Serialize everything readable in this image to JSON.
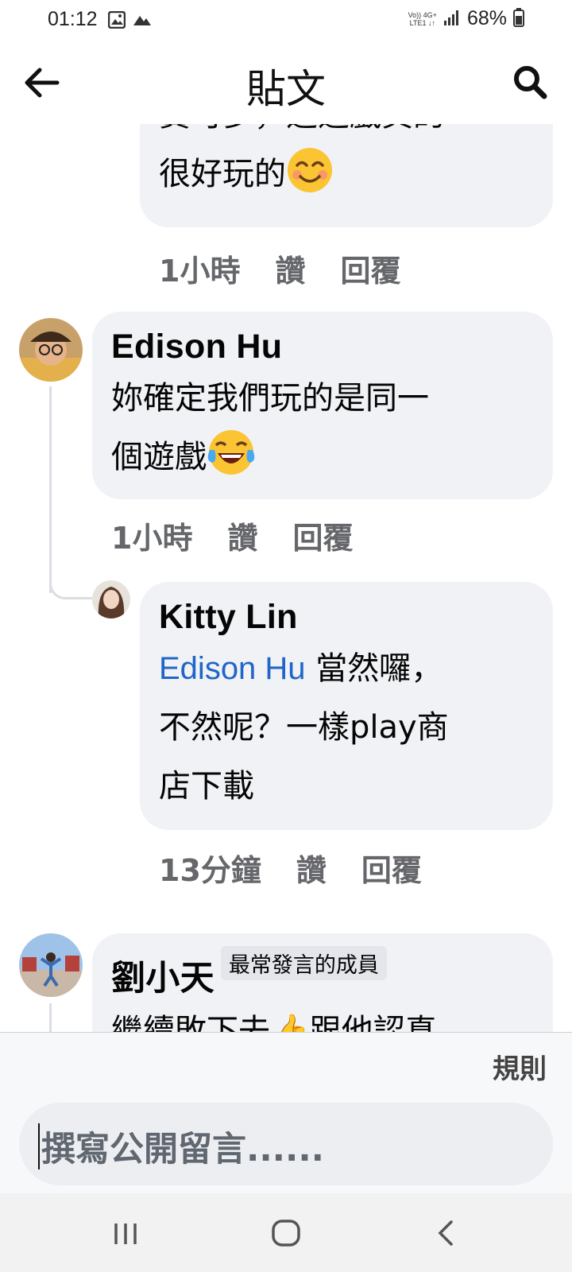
{
  "status_bar": {
    "time": "01:12",
    "icons_left": [
      "image-icon",
      "cloud-icon"
    ],
    "network_top": "Vo)) 4G+",
    "network_bottom": "LTE1 ↓↑",
    "battery": "68%"
  },
  "header": {
    "title": "貼文",
    "back_icon": "arrow-left-icon",
    "search_icon": "search-icon"
  },
  "comments": [
    {
      "text_partial": "寶可夢，這遊戲真的",
      "text_line2": "很好玩的",
      "emoji": "smiling-face-emoji",
      "time": "1小時",
      "like": "讚",
      "reply": "回覆"
    },
    {
      "author": "Edison Hu",
      "text_line1": "妳確定我們玩的是同一",
      "text_line2": "個遊戲",
      "emoji": "tears-of-joy-emoji",
      "time": "1小時",
      "like": "讚",
      "reply": "回覆"
    },
    {
      "author": "Kitty Lin",
      "mention": "Edison Hu",
      "text_line1": " 當然囉，",
      "text_line2": "不然呢？一樣play商",
      "text_line3": "店下載",
      "time": "13分鐘",
      "like": "讚",
      "reply": "回覆"
    },
    {
      "author": "劉小天",
      "badge": "最常發言的成員",
      "text_partial": "繼續敗下去👍跟他認真"
    }
  ],
  "composer": {
    "rules": "規則",
    "placeholder": "撰寫公開留言......"
  },
  "colors": {
    "bubble": "#f0f2f5",
    "mention": "#2066c8",
    "meta": "#65676b"
  },
  "nav": [
    "recent-apps-icon",
    "home-icon",
    "back-icon"
  ]
}
